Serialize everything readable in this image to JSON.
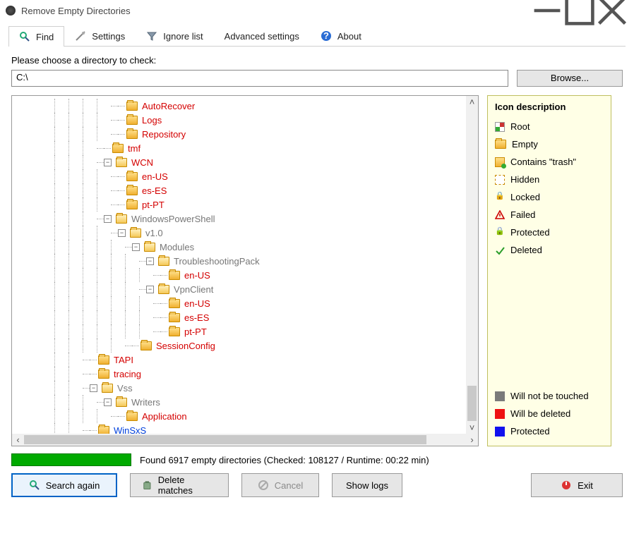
{
  "window": {
    "title": "Remove Empty Directories"
  },
  "tabs": {
    "find": "Find",
    "settings": "Settings",
    "ignore": "Ignore list",
    "advanced": "Advanced settings",
    "about": "About"
  },
  "prompt": "Please choose a directory to check:",
  "path": "C:\\",
  "browse": "Browse...",
  "tree": [
    {
      "depth": 4,
      "toggle": "",
      "label": "AutoRecover",
      "cls": "red"
    },
    {
      "depth": 4,
      "toggle": "",
      "label": "Logs",
      "cls": "red"
    },
    {
      "depth": 4,
      "toggle": "",
      "label": "Repository",
      "cls": "red"
    },
    {
      "depth": 3,
      "toggle": "",
      "label": "tmf",
      "cls": "red"
    },
    {
      "depth": 3,
      "toggle": "-",
      "label": "WCN",
      "cls": "red"
    },
    {
      "depth": 4,
      "toggle": "",
      "label": "en-US",
      "cls": "red"
    },
    {
      "depth": 4,
      "toggle": "",
      "label": "es-ES",
      "cls": "red"
    },
    {
      "depth": 4,
      "toggle": "",
      "label": "pt-PT",
      "cls": "red"
    },
    {
      "depth": 3,
      "toggle": "-",
      "label": "WindowsPowerShell",
      "cls": "gray"
    },
    {
      "depth": 4,
      "toggle": "-",
      "label": "v1.0",
      "cls": "gray"
    },
    {
      "depth": 5,
      "toggle": "-",
      "label": "Modules",
      "cls": "gray"
    },
    {
      "depth": 6,
      "toggle": "-",
      "label": "TroubleshootingPack",
      "cls": "gray"
    },
    {
      "depth": 7,
      "toggle": "",
      "label": "en-US",
      "cls": "red"
    },
    {
      "depth": 6,
      "toggle": "-",
      "label": "VpnClient",
      "cls": "gray"
    },
    {
      "depth": 7,
      "toggle": "",
      "label": "en-US",
      "cls": "red"
    },
    {
      "depth": 7,
      "toggle": "",
      "label": "es-ES",
      "cls": "red"
    },
    {
      "depth": 7,
      "toggle": "",
      "label": "pt-PT",
      "cls": "red"
    },
    {
      "depth": 5,
      "toggle": "",
      "label": "SessionConfig",
      "cls": "red"
    },
    {
      "depth": 2,
      "toggle": "",
      "label": "TAPI",
      "cls": "red"
    },
    {
      "depth": 2,
      "toggle": "",
      "label": "tracing",
      "cls": "red"
    },
    {
      "depth": 2,
      "toggle": "-",
      "label": "Vss",
      "cls": "gray"
    },
    {
      "depth": 3,
      "toggle": "-",
      "label": "Writers",
      "cls": "gray"
    },
    {
      "depth": 4,
      "toggle": "",
      "label": "Application",
      "cls": "red"
    },
    {
      "depth": 2,
      "toggle": "",
      "label": "WinSxS",
      "cls": "blue"
    }
  ],
  "legend": {
    "title": "Icon description",
    "items": {
      "root": "Root",
      "empty": "Empty",
      "trash": "Contains \"trash\"",
      "hidden": "Hidden",
      "locked": "Locked",
      "failed": "Failed",
      "protected": "Protected",
      "deleted": "Deleted",
      "untouched": "Will not be touched",
      "willdelete": "Will be deleted",
      "protected2": "Protected"
    }
  },
  "status": "Found 6917 empty directories (Checked: 108127 / Runtime: 00:22 min)",
  "buttons": {
    "search": "Search again",
    "delete": "Delete matches",
    "cancel": "Cancel",
    "logs": "Show logs",
    "exit": "Exit"
  }
}
